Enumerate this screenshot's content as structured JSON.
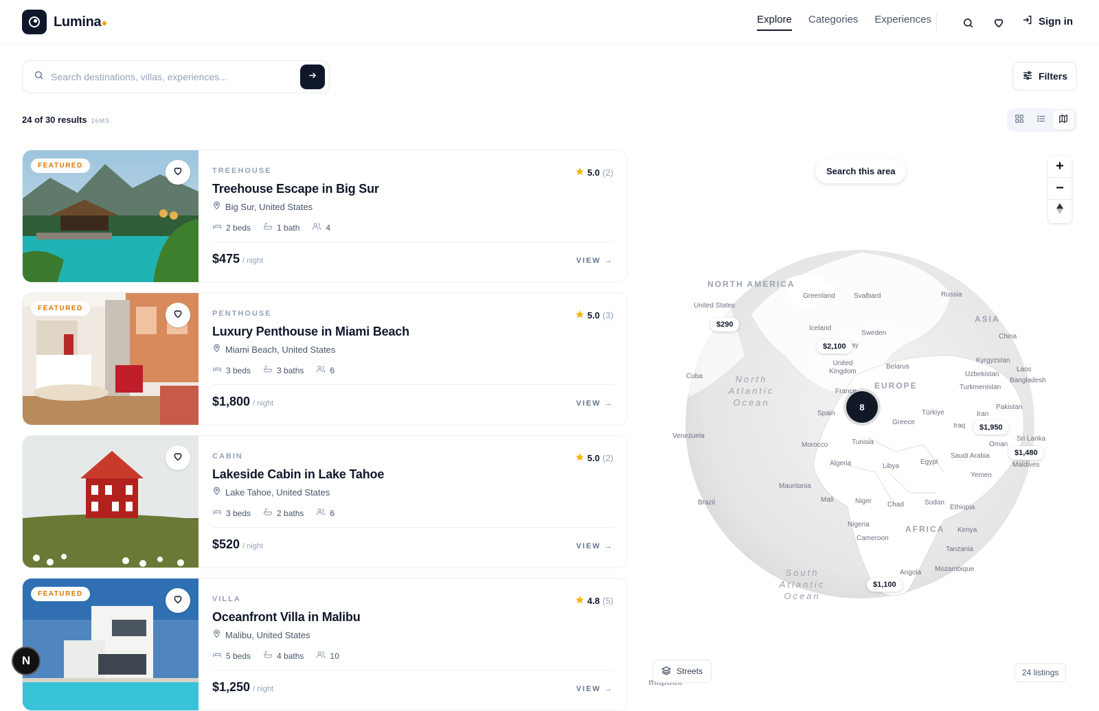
{
  "brand": {
    "name": "Lumina"
  },
  "nav": {
    "explore": "Explore",
    "categories": "Categories",
    "experiences": "Experiences",
    "sign_in": "Sign in"
  },
  "search": {
    "placeholder": "Search destinations, villas, experiences...",
    "value": ""
  },
  "filters_label": "Filters",
  "results": {
    "summary": "24 of 30 results",
    "timing": "16MS"
  },
  "listings": [
    {
      "featured": "FEATURED",
      "type": "TREEHOUSE",
      "title": "Treehouse Escape in Big Sur",
      "location": "Big Sur, United States",
      "beds": "2 beds",
      "baths": "1 bath",
      "guests": "4",
      "rating": "5.0",
      "reviews": "(2)",
      "price": "$475",
      "per": "/ night",
      "view": "VIEW →"
    },
    {
      "featured": "FEATURED",
      "type": "PENTHOUSE",
      "title": "Luxury Penthouse in Miami Beach",
      "location": "Miami Beach, United States",
      "beds": "3 beds",
      "baths": "3 baths",
      "guests": "6",
      "rating": "5.0",
      "reviews": "(3)",
      "price": "$1,800",
      "per": "/ night",
      "view": "VIEW →"
    },
    {
      "featured": "",
      "type": "CABIN",
      "title": "Lakeside Cabin in Lake Tahoe",
      "location": "Lake Tahoe, United States",
      "beds": "3 beds",
      "baths": "2 baths",
      "guests": "6",
      "rating": "5.0",
      "reviews": "(2)",
      "price": "$520",
      "per": "/ night",
      "view": "VIEW →"
    },
    {
      "featured": "FEATURED",
      "type": "VILLA",
      "title": "Oceanfront Villa in Malibu",
      "location": "Malibu, United States",
      "beds": "5 beds",
      "baths": "4 baths",
      "guests": "10",
      "rating": "4.8",
      "reviews": "(5)",
      "price": "$1,250",
      "per": "/ night",
      "view": "VIEW →"
    }
  ],
  "map": {
    "search_area": "Search this area",
    "cluster_count": "8",
    "pins": [
      "$290",
      "$2,100",
      "$1,950",
      "$1,480",
      "$1,100"
    ],
    "labels": {
      "north_america": "NORTH AMERICA",
      "united_states": "United States",
      "greenland": "Greenland",
      "svalbard": "Svalbard",
      "russia": "Russia",
      "asia": "ASIA",
      "china": "China",
      "iceland": "Iceland",
      "sweden": "Sweden",
      "norway": "Norway",
      "united_kingdom": "United Kingdom",
      "belarus": "Belarus",
      "kyrgyzstan": "Kyrgyzstan",
      "uzbekistan": "Uzbekistan",
      "laos": "Laos",
      "bangladesh": "Bangladesh",
      "turkmenistan": "Turkmenistan",
      "cuba": "Cuba",
      "north_atlantic": "North Atlantic Ocean",
      "europe": "EUROPE",
      "france": "France",
      "spain": "Spain",
      "turkiye": "Türkiye",
      "pakistan": "Pakistan",
      "iran": "Iran",
      "greece": "Greece",
      "iraq": "Iraq",
      "venezuela": "Venezuela",
      "morocco": "Morocco",
      "tunisia": "Tunisia",
      "oman": "Oman",
      "sri_lanka": "Sri Lanka",
      "saudi_arabia": "Saudi Arabia",
      "maldives": "Maldives",
      "algeria": "Algeria",
      "libya": "Libya",
      "egypt": "Egypt",
      "yemen": "Yemen",
      "mauritania": "Mauritania",
      "brazil": "Brazil",
      "mali": "Mali",
      "niger": "Niger",
      "chad": "Chad",
      "sudan": "Sudan",
      "ethiopia": "Ethiopia",
      "nigeria": "Nigeria",
      "africa": "AFRICA",
      "kenya": "Kenya",
      "cameroon": "Cameroon",
      "tanzania": "Tanzania",
      "south_atlantic": "South Atlantic Ocean",
      "mozambique": "Mozambique",
      "angola": "Angola"
    },
    "style_label": "Streets",
    "listings_count": "24 listings",
    "attribution": "mapbox"
  },
  "badge": "N",
  "colors": {
    "primary": "#0f172a",
    "accent": "#f59e0b",
    "star": "#f5b301",
    "muted": "#94a3b8"
  }
}
